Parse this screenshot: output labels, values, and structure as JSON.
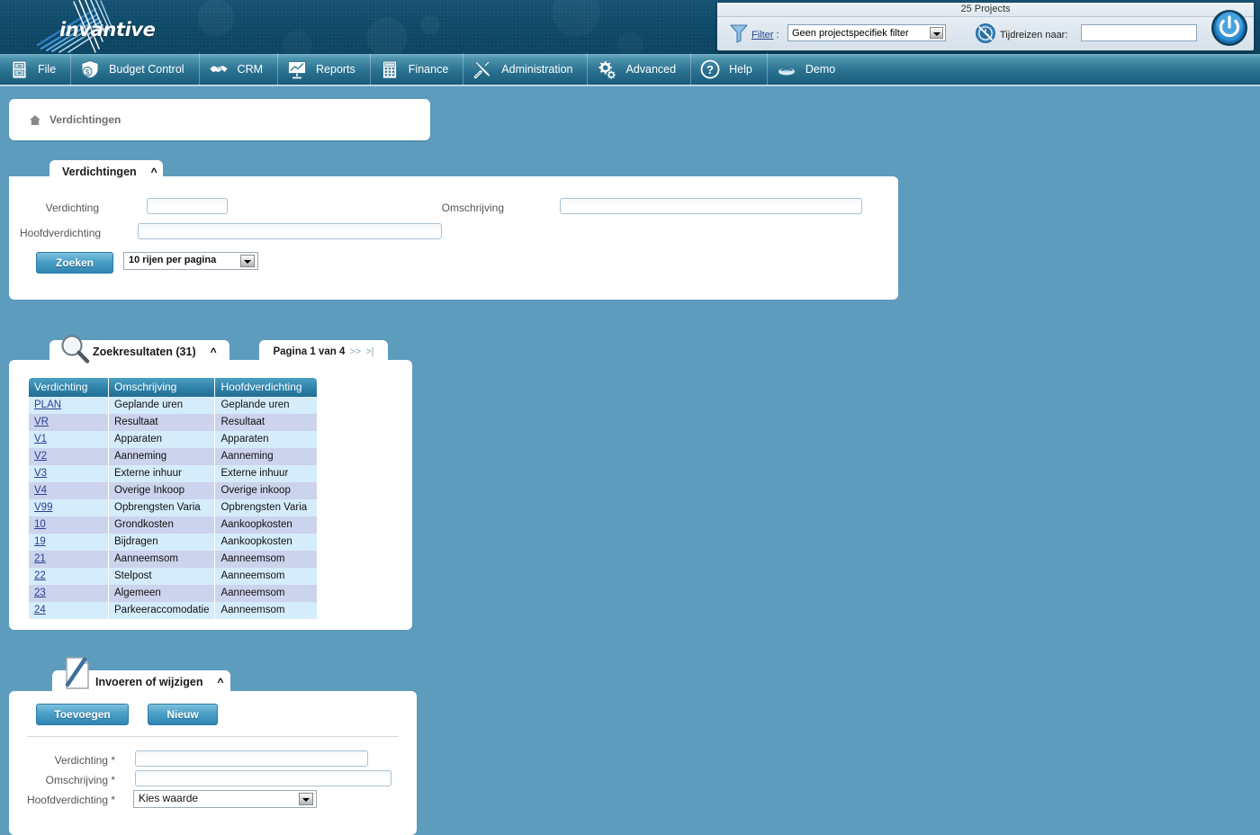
{
  "header": {
    "logo_text": "invantive",
    "logo_icon": "starburst-logo-icon"
  },
  "filter_panel": {
    "title": "25 Projects",
    "funnel_icon": "funnel-icon",
    "filter_label": "Filter",
    "filter_label_suffix": " :",
    "filter_value": "Geen projectspecifiek filter",
    "clock_icon": "time-travel-clock-icon",
    "timetravel_label": "Tijdreizen naar:",
    "timetravel_value": "",
    "power_icon": "power-button-icon"
  },
  "menu": {
    "items": [
      {
        "label": "File",
        "icon": "filing-cabinet-icon"
      },
      {
        "label": "Budget Control",
        "icon": "money-shield-icon"
      },
      {
        "label": "CRM",
        "icon": "handshake-icon"
      },
      {
        "label": "Reports",
        "icon": "presentation-chart-icon"
      },
      {
        "label": "Finance",
        "icon": "calculator-icon"
      },
      {
        "label": "Administration",
        "icon": "tools-icon"
      },
      {
        "label": "Advanced",
        "icon": "gears-icon"
      },
      {
        "label": "Help",
        "icon": "question-mark-icon"
      },
      {
        "label": "Demo",
        "icon": "user-avatar-icon"
      }
    ]
  },
  "breadcrumb": {
    "home_icon": "home-icon",
    "text": "Verdichtingen"
  },
  "search_panel": {
    "tab_label": "Verdichtingen",
    "collapse_icon": "chevron-up-icon",
    "fields": {
      "verdichting_label": "Verdichting",
      "verdichting_value": "",
      "hoofdverdichting_label": "Hoofdverdichting",
      "hoofdverdichting_value": "",
      "omschrijving_label": "Omschrijving",
      "omschrijving_value": ""
    },
    "search_button": "Zoeken",
    "rows_per_page": "10 rijen per pagina"
  },
  "results_panel": {
    "tab_label": "Zoekresultaten (31)",
    "search_icon": "magnifier-icon",
    "collapse_icon": "chevron-up-icon",
    "pagination": {
      "text": "Pagina 1 van 4",
      "next": ">>",
      "last": ">|"
    },
    "columns": [
      "Verdichting",
      "Omschrijving",
      "Hoofdverdichting"
    ],
    "rows": [
      {
        "verdichting": "PLAN",
        "omschrijving": "Geplande uren",
        "hoofdverdichting": "Geplande uren"
      },
      {
        "verdichting": "VR",
        "omschrijving": "Resultaat",
        "hoofdverdichting": "Resultaat"
      },
      {
        "verdichting": "V1",
        "omschrijving": "Apparaten",
        "hoofdverdichting": "Apparaten"
      },
      {
        "verdichting": "V2",
        "omschrijving": "Aanneming",
        "hoofdverdichting": "Aanneming"
      },
      {
        "verdichting": "V3",
        "omschrijving": "Externe inhuur",
        "hoofdverdichting": "Externe inhuur"
      },
      {
        "verdichting": "V4",
        "omschrijving": "Overige Inkoop",
        "hoofdverdichting": "Overige inkoop"
      },
      {
        "verdichting": "V99",
        "omschrijving": "Opbrengsten Varia",
        "hoofdverdichting": "Opbrengsten Varia"
      },
      {
        "verdichting": "10",
        "omschrijving": "Grondkosten",
        "hoofdverdichting": "Aankoopkosten"
      },
      {
        "verdichting": "19",
        "omschrijving": "Bijdragen",
        "hoofdverdichting": "Aankoopkosten"
      },
      {
        "verdichting": "21",
        "omschrijving": "Aanneemsom",
        "hoofdverdichting": "Aanneemsom"
      },
      {
        "verdichting": "22",
        "omschrijving": "Stelpost",
        "hoofdverdichting": "Aanneemsom"
      },
      {
        "verdichting": "23",
        "omschrijving": "Algemeen",
        "hoofdverdichting": "Aanneemsom"
      },
      {
        "verdichting": "24",
        "omschrijving": "Parkeeraccomodatie",
        "hoofdverdichting": "Aanneemsom"
      }
    ]
  },
  "edit_panel": {
    "tab_label": "Invoeren of wijzigen",
    "pencil_icon": "document-pencil-icon",
    "collapse_icon": "chevron-up-icon",
    "add_button": "Toevoegen",
    "new_button": "Nieuw",
    "fields": {
      "verdichting_label": "Verdichting *",
      "verdichting_value": "",
      "omschrijving_label": "Omschrijving *",
      "omschrijving_value": "",
      "hoofdverdichting_label": "Hoofdverdichting *",
      "hoofdverdichting_value": "Kies waarde"
    }
  },
  "colors": {
    "page_background": "#5e9cbe",
    "header_dark": "#0e4a68",
    "menu_bar": "#2a7190",
    "table_header": "#2f81a8",
    "row_odd": "#d5ecfb",
    "row_even": "#ccd3ec",
    "button_blue": "#4c9fc6",
    "link": "#2b3f8f"
  }
}
